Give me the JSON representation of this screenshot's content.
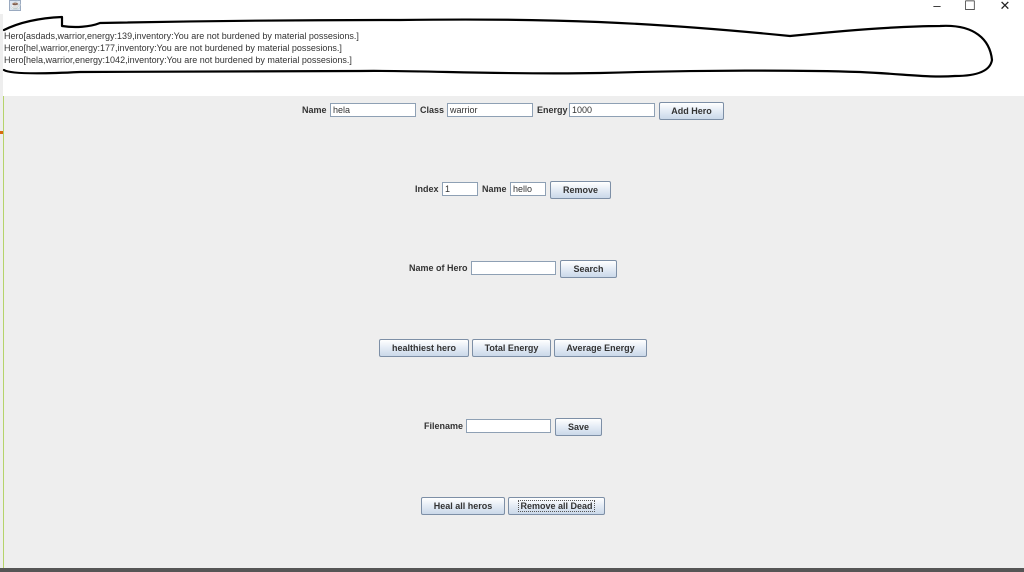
{
  "window": {
    "minimize_icon": "–",
    "maximize_icon": "☐",
    "close_icon": "✕",
    "app_icon": "java-cup-icon"
  },
  "output": {
    "lines": [
      "Hero[asdads,warrior,energy:139,inventory:You are not burdened by material possesions.]",
      "Hero[hel,warrior,energy:177,inventory:You are not burdened by material possesions.]",
      "Hero[hela,warrior,energy:1042,inventory:You are not burdened by material possesions.]"
    ]
  },
  "add_hero": {
    "name_label": "Name",
    "name_value": "hela",
    "class_label": "Class",
    "class_value": "warrior",
    "energy_label": "Energy",
    "energy_value": "1000",
    "button": "Add Hero"
  },
  "remove_hero": {
    "index_label": "Index",
    "index_value": "1",
    "name_label": "Name",
    "name_value": "hello",
    "button": "Remove"
  },
  "search": {
    "label": "Name of Hero",
    "value": "",
    "button": "Search"
  },
  "stats": {
    "healthiest_button": "healthiest hero",
    "total_button": "Total Energy",
    "average_button": "Average Energy"
  },
  "save": {
    "label": "Filename",
    "value": "",
    "button": "Save"
  },
  "bulk": {
    "heal_button": "Heal all heros",
    "remove_dead_button": "Remove all Dead"
  }
}
